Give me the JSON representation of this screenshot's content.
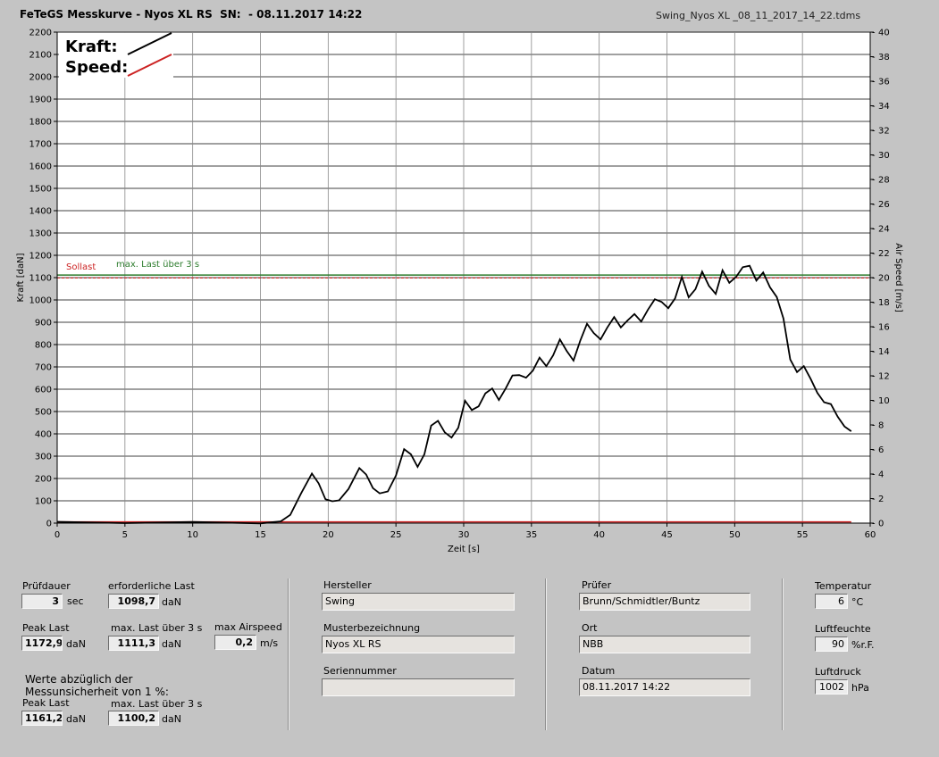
{
  "header": {
    "title": "FeTeGS Messkurve - Nyos XL RS  SN:  - 08.11.2017 14:22",
    "filename": "Swing_Nyos XL _08_11_2017_14_22.tdms"
  },
  "legend": {
    "kraft": "Kraft:",
    "speed": "Speed:"
  },
  "annotations": {
    "sollast": "Sollast",
    "max_last": "max. Last über  3 s"
  },
  "colors": {
    "kraft": "#000000",
    "speed": "#cc2222",
    "sollast": "#cc2222",
    "max_last": "#2e7d2e",
    "plot_bg": "#ffffff",
    "panel_bg": "#c4c4c4"
  },
  "chart_data": {
    "type": "line",
    "xlabel": "Zeit [s]",
    "ylabel": "Kraft [daN]",
    "y2label": "Air Speed [m/s]",
    "xlim": [
      0,
      60
    ],
    "ylim": [
      0,
      2200
    ],
    "y2lim": [
      0,
      40
    ],
    "xticks": [
      "0",
      "5",
      "10",
      "15",
      "20",
      "25",
      "30",
      "35",
      "40",
      "45",
      "50",
      "55",
      "60"
    ],
    "yticks": [
      "0",
      "100",
      "200",
      "300",
      "400",
      "500",
      "600",
      "700",
      "800",
      "900",
      "1000",
      "1100",
      "1200",
      "1300",
      "1400",
      "1500",
      "1600",
      "1700",
      "1800",
      "1900",
      "2000",
      "2100",
      "2200"
    ],
    "y2ticks": [
      "0",
      "2",
      "4",
      "6",
      "8",
      "10",
      "12",
      "14",
      "16",
      "18",
      "20",
      "22",
      "24",
      "26",
      "28",
      "30",
      "32",
      "34",
      "36",
      "38",
      "40"
    ],
    "grid": true,
    "legend_position": "top-left",
    "reference_lines": [
      {
        "name": "Sollast",
        "y": 1098.7
      },
      {
        "name": "max. Last über  3 s",
        "y": 1111.3
      }
    ],
    "series": [
      {
        "name": "Kraft",
        "axis": "left",
        "x": [
          0,
          5,
          10,
          15,
          16.5,
          17.2,
          18,
          18.8,
          19.3,
          19.8,
          20.3,
          20.8,
          21.5,
          22.3,
          22.8,
          23.3,
          23.8,
          24.4,
          25,
          25.6,
          26.1,
          26.6,
          27.1,
          27.6,
          28.1,
          28.6,
          29.1,
          29.6,
          30.1,
          30.6,
          31.1,
          31.6,
          32.1,
          32.6,
          33.1,
          33.6,
          34.1,
          34.6,
          35.1,
          35.6,
          36.1,
          36.6,
          37.1,
          37.6,
          38.1,
          38.6,
          39.1,
          39.6,
          40.1,
          40.6,
          41.1,
          41.6,
          42.1,
          42.6,
          43.1,
          43.6,
          44.1,
          44.6,
          45.1,
          45.6,
          46.1,
          46.6,
          47.1,
          47.6,
          48.1,
          48.6,
          49.1,
          49.6,
          50.1,
          50.6,
          51.1,
          51.6,
          52.1,
          52.6,
          53.1,
          53.6,
          54.1,
          54.6,
          55.1,
          55.6,
          56.1,
          56.6,
          57.1,
          57.6,
          58.1,
          58.6
        ],
        "y": [
          3,
          3,
          2,
          2,
          5,
          40,
          130,
          225,
          175,
          110,
          95,
          105,
          150,
          250,
          215,
          160,
          130,
          145,
          210,
          335,
          305,
          255,
          305,
          440,
          455,
          410,
          380,
          430,
          545,
          510,
          520,
          585,
          600,
          555,
          600,
          665,
          660,
          655,
          680,
          745,
          700,
          755,
          820,
          775,
          725,
          820,
          890,
          855,
          820,
          880,
          920,
          880,
          905,
          940,
          900,
          960,
          1000,
          995,
          960,
          1010,
          1100,
          1015,
          1045,
          1130,
          1060,
          1030,
          1130,
          1080,
          1100,
          1150,
          1150,
          1090,
          1120,
          1060,
          1010,
          920,
          730,
          680,
          700,
          650,
          580,
          545,
          530,
          480,
          430,
          415
        ]
      },
      {
        "name": "Speed",
        "axis": "right",
        "x": [
          0,
          58.6
        ],
        "y": [
          0.1,
          0.1
        ]
      }
    ]
  },
  "footer": {
    "pruefdauer": {
      "label": "Prüfdauer",
      "value": "3",
      "unit": "sec"
    },
    "erforderlich": {
      "label": "erforderliche Last",
      "value": "1098,7",
      "unit": "daN"
    },
    "peak_last": {
      "label": "Peak Last",
      "value": "1172,9",
      "unit": "daN"
    },
    "max_last_3s": {
      "label": "max. Last über  3 s",
      "value": "1111,3",
      "unit": "daN"
    },
    "max_airspeed": {
      "label": "max Airspeed",
      "value": "0,2",
      "unit": "m/s"
    },
    "werte_note": {
      "line1": "Werte abzüglich der",
      "line2": "Messunsicherheit von 1  %:"
    },
    "peak_last_corr": {
      "label": "Peak Last",
      "value": "1161,2",
      "unit": "daN"
    },
    "max_last_corr": {
      "label": "max. Last über  3 s",
      "value": "1100,2",
      "unit": "daN"
    },
    "hersteller": {
      "label": "Hersteller",
      "value": "Swing"
    },
    "muster": {
      "label": "Musterbezeichnung",
      "value": "Nyos XL RS"
    },
    "seriennummer": {
      "label": "Seriennummer",
      "value": ""
    },
    "pruefer": {
      "label": "Prüfer",
      "value": "Brunn/Schmidtler/Buntz"
    },
    "ort": {
      "label": "Ort",
      "value": "NBB"
    },
    "datum": {
      "label": "Datum",
      "value": "08.11.2017 14:22"
    },
    "temperatur": {
      "label": "Temperatur",
      "value": "6",
      "unit": "°C"
    },
    "luftfeuchte": {
      "label": "Luftfeuchte",
      "value": "90",
      "unit": "%r.F."
    },
    "luftdruck": {
      "label": "Luftdruck",
      "value": "1002",
      "unit": "hPa"
    }
  }
}
